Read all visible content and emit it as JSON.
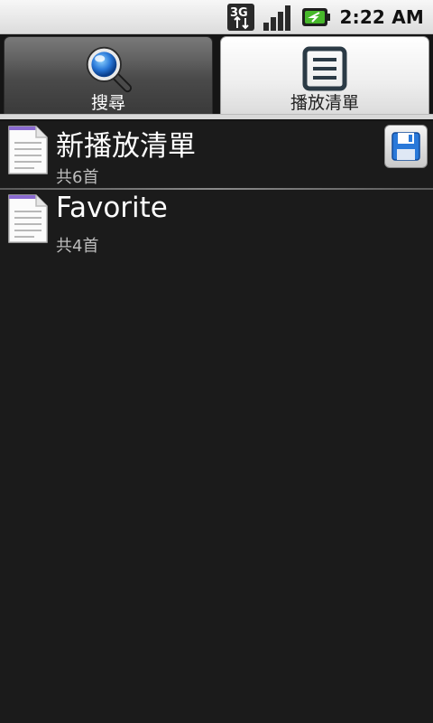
{
  "status_bar": {
    "network_label": "3G",
    "time": "2:22 AM",
    "icons": [
      "3g-data-icon",
      "signal-strength-icon",
      "battery-charging-icon"
    ]
  },
  "tabs": [
    {
      "label": "搜尋",
      "icon": "search-icon",
      "selected": false
    },
    {
      "label": "播放清單",
      "icon": "list-icon",
      "selected": true
    }
  ],
  "playlists": [
    {
      "title": "新播放清單",
      "subtitle": "共6首",
      "icon": "document-icon",
      "has_save_button": true
    },
    {
      "title": "Favorite",
      "subtitle": "共4首",
      "icon": "document-icon",
      "has_save_button": false
    }
  ],
  "colors": {
    "background": "#1b1b1b",
    "accent_blue": "#2a79d9",
    "doc_purple": "#8a6ad0"
  }
}
